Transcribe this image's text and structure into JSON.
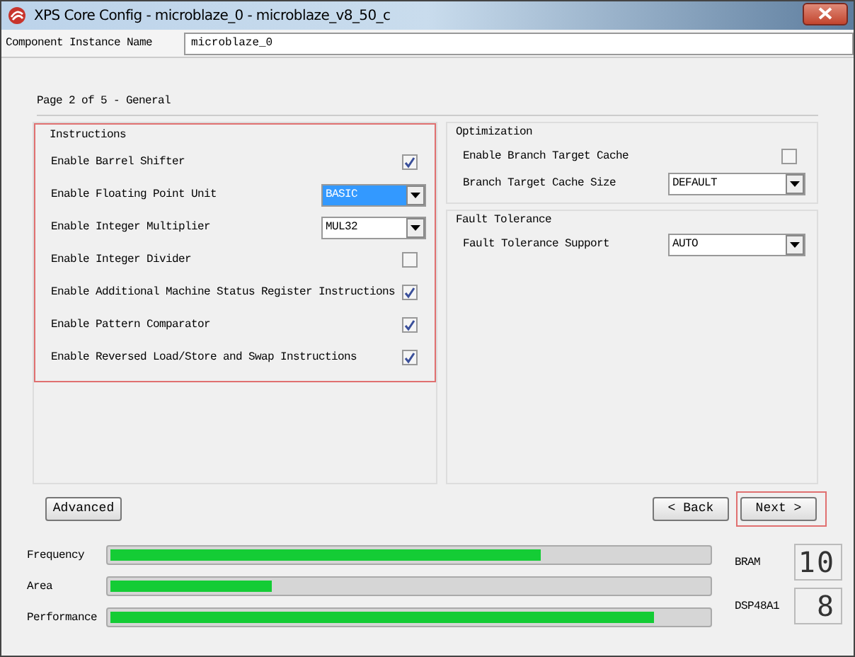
{
  "window": {
    "title": "XPS Core Config - microblaze_0 - microblaze_v8_50_c"
  },
  "instance": {
    "label": "Component Instance Name",
    "value": "microblaze_0"
  },
  "page_label": "Page 2 of 5 - General",
  "left_groups": [
    {
      "title": "Instructions",
      "highlighted": true,
      "rows": [
        {
          "kind": "checkbox",
          "label": "Enable Barrel Shifter",
          "checked": true
        },
        {
          "kind": "select",
          "label": "Enable Floating Point Unit",
          "value": "BASIC",
          "focused": true
        },
        {
          "kind": "select",
          "label": "Enable Integer Multiplier",
          "value": "MUL32",
          "focused": false
        },
        {
          "kind": "checkbox",
          "label": "Enable Integer Divider",
          "checked": false
        },
        {
          "kind": "checkbox",
          "label": "Enable Additional Machine Status Register Instructions",
          "checked": true
        },
        {
          "kind": "checkbox",
          "label": "Enable Pattern Comparator",
          "checked": true
        },
        {
          "kind": "checkbox",
          "label": "Enable Reversed Load/Store and Swap Instructions",
          "checked": true
        }
      ]
    }
  ],
  "right_groups": [
    {
      "title": "Optimization",
      "highlighted": false,
      "rows": [
        {
          "kind": "checkbox",
          "label": "Enable Branch Target Cache",
          "checked": false
        },
        {
          "kind": "select",
          "label": "Branch Target Cache Size",
          "value": "DEFAULT",
          "focused": false
        }
      ]
    },
    {
      "title": "Fault Tolerance",
      "highlighted": false,
      "rows": [
        {
          "kind": "select",
          "label": "Fault Tolerance Support",
          "value": "AUTO",
          "focused": false
        }
      ]
    }
  ],
  "buttons": [
    {
      "label": "Advanced",
      "highlighted": false
    },
    {
      "label": "< Back",
      "highlighted": false
    },
    {
      "label": "Next >",
      "highlighted": true
    }
  ],
  "meters": [
    {
      "name": "Frequency",
      "level": 0.72
    },
    {
      "name": "Area",
      "level": 0.27
    },
    {
      "name": "Performance",
      "level": 0.91
    }
  ],
  "resources": [
    {
      "name": "BRAM",
      "value": "10"
    },
    {
      "name": "DSP48A1",
      "value": "8"
    }
  ]
}
